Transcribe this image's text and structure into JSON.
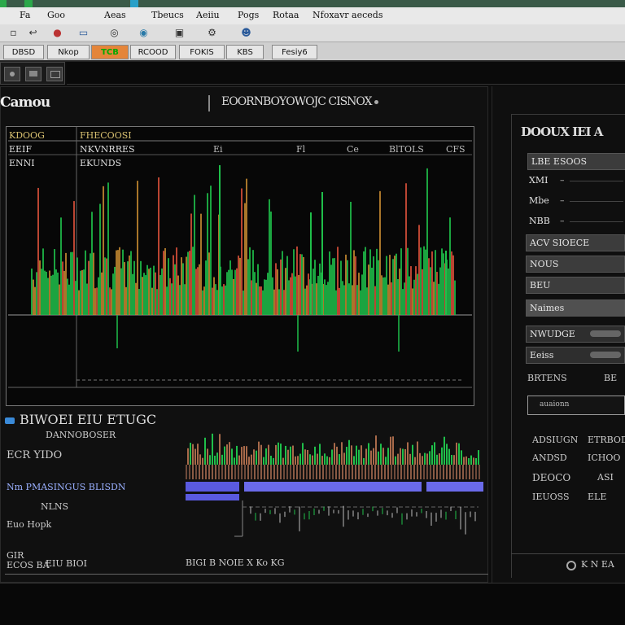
{
  "menubar": {
    "items": [
      "Fa",
      "Goo",
      "Aeas",
      "Tbeucs",
      "Aeiiu",
      "Pogs",
      "Rotaa",
      "Nfoxavr aeceds"
    ]
  },
  "tabs": [
    {
      "label": "DBSD",
      "active": false
    },
    {
      "label": "Nkop",
      "active": false
    },
    {
      "label": "TCB",
      "active": true
    },
    {
      "label": "RCOOD",
      "active": false
    },
    {
      "label": "FOKIS",
      "active": false
    },
    {
      "label": "KBS",
      "active": false
    },
    {
      "label": "Fesiy6",
      "active": false
    }
  ],
  "app": {
    "title": "Camou",
    "center_title": "EOORNBOYOWOJC CISNOX"
  },
  "chart": {
    "legend_rows": [
      {
        "col1": "KDOOG",
        "col2": "FHECOOSI"
      },
      {
        "col1": "EEIF",
        "col2": "NKVNRRES"
      },
      {
        "col1": "ENNI",
        "col2": "EKUNDS"
      }
    ],
    "top_ticks": [
      "Ei",
      "Fl",
      "Ce",
      "BlTOLS",
      "CFS"
    ],
    "colors": {
      "green": "#1fbf4a",
      "red": "#d9503a",
      "amber": "#c58a30",
      "baseline": "#888888"
    }
  },
  "lower": {
    "title": "BIWOEI EIU ETUGC",
    "subtitle": "DANNOBOSER",
    "labels": [
      {
        "text": "ECR YIDO"
      },
      {
        "text": "Nm PMASINGUS BLISDN"
      },
      {
        "text": "NLNS"
      },
      {
        "text": "Euo Hopk"
      },
      {
        "text": "GIR"
      },
      {
        "text": "ECOS BA"
      },
      {
        "text": "EIU BIOI"
      }
    ],
    "footer_readout": "BIGI B  NOIE  X Ko  KG"
  },
  "right_panel": {
    "title": "DOOUX IEI A",
    "rows": [
      {
        "label": "LBE ESOOS"
      },
      {
        "label": "XMI",
        "dash": true
      },
      {
        "label": "Mbe",
        "dash": true
      },
      {
        "label": "NBB",
        "dash": true
      },
      {
        "label": "ACV SIOECE"
      },
      {
        "label": "NOUS"
      },
      {
        "label": "BEU"
      },
      {
        "label": "Naimes",
        "slider": true
      },
      {
        "label": "NWUDGE",
        "slider": true
      },
      {
        "label": "Eeiss",
        "slider": true
      }
    ],
    "under_rows": {
      "left": "BRTENS",
      "right": "BE"
    },
    "input_value": "auaionn",
    "info": [
      {
        "left": "ADSIUGN",
        "right": "ETRBOD"
      },
      {
        "left": "ANDSD",
        "right": "ICHOO"
      },
      {
        "left": "DEOCO",
        "right": "ASI"
      },
      {
        "left": "IEUOSS",
        "right": "ELE"
      }
    ],
    "footer": "K N EA"
  }
}
